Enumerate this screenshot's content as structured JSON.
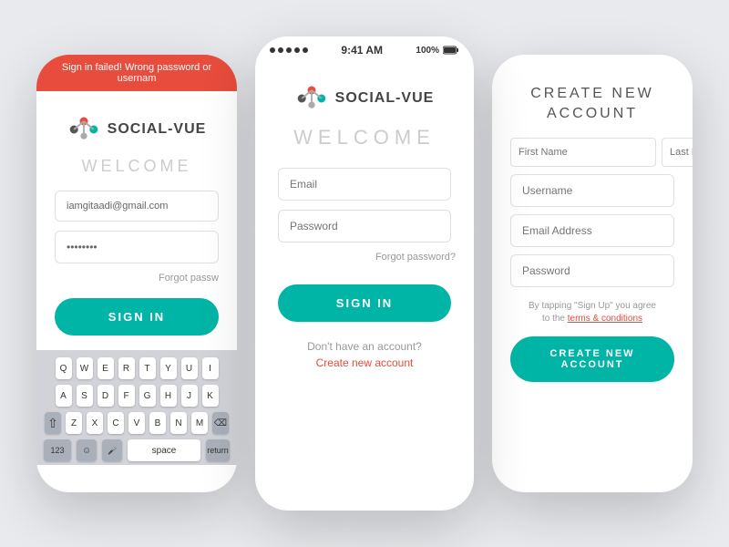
{
  "background_color": "#e8eaed",
  "accent_color": "#00b5a5",
  "error_color": "#e74c3c",
  "phone_left": {
    "error_banner": "Sign in failed! Wrong password or usernam",
    "logo_text": "SOCIAL-VUE",
    "welcome": "WELCOME",
    "email_value": "iamgitaadi@gmail.com",
    "password_value": "••••••••",
    "forgot_label": "Forgot passw",
    "signin_label": "SIGN IN"
  },
  "phone_center": {
    "status_time": "9:41 AM",
    "status_battery": "100%",
    "logo_text": "SOCIAL-VUE",
    "welcome": "WELCOME",
    "email_placeholder": "Email",
    "password_placeholder": "Password",
    "forgot_label": "Forgot password?",
    "signin_label": "SIGN IN",
    "dont_have_label": "Don't have an account?",
    "create_link_label": "Create new account"
  },
  "phone_right": {
    "title_line1": "CREATE NEW",
    "title_line2": "ACCOUNT",
    "first_name_placeholder": "First Name",
    "last_name_placeholder": "Last Name",
    "username_placeholder": "Username",
    "email_placeholder": "Email Address",
    "password_placeholder": "Password",
    "terms_text_pre": "By tapping \"Sign Up\" you agree to the ",
    "terms_link_label": "terms & conditions",
    "terms_text_post": "",
    "create_btn_label": "CREATE NEW ACCOUNT"
  },
  "keyboard": {
    "row1": [
      "Q",
      "W",
      "E",
      "R",
      "T",
      "Y",
      "U",
      "I"
    ],
    "row2": [
      "A",
      "S",
      "D",
      "F",
      "G",
      "H",
      "J",
      "K"
    ],
    "row3": [
      "Z",
      "X",
      "C",
      "V",
      "B",
      "N",
      "M"
    ],
    "bottom_left": "123",
    "emoji": "☺",
    "mic": "🎤",
    "space": "space",
    "delete": "⌫"
  }
}
